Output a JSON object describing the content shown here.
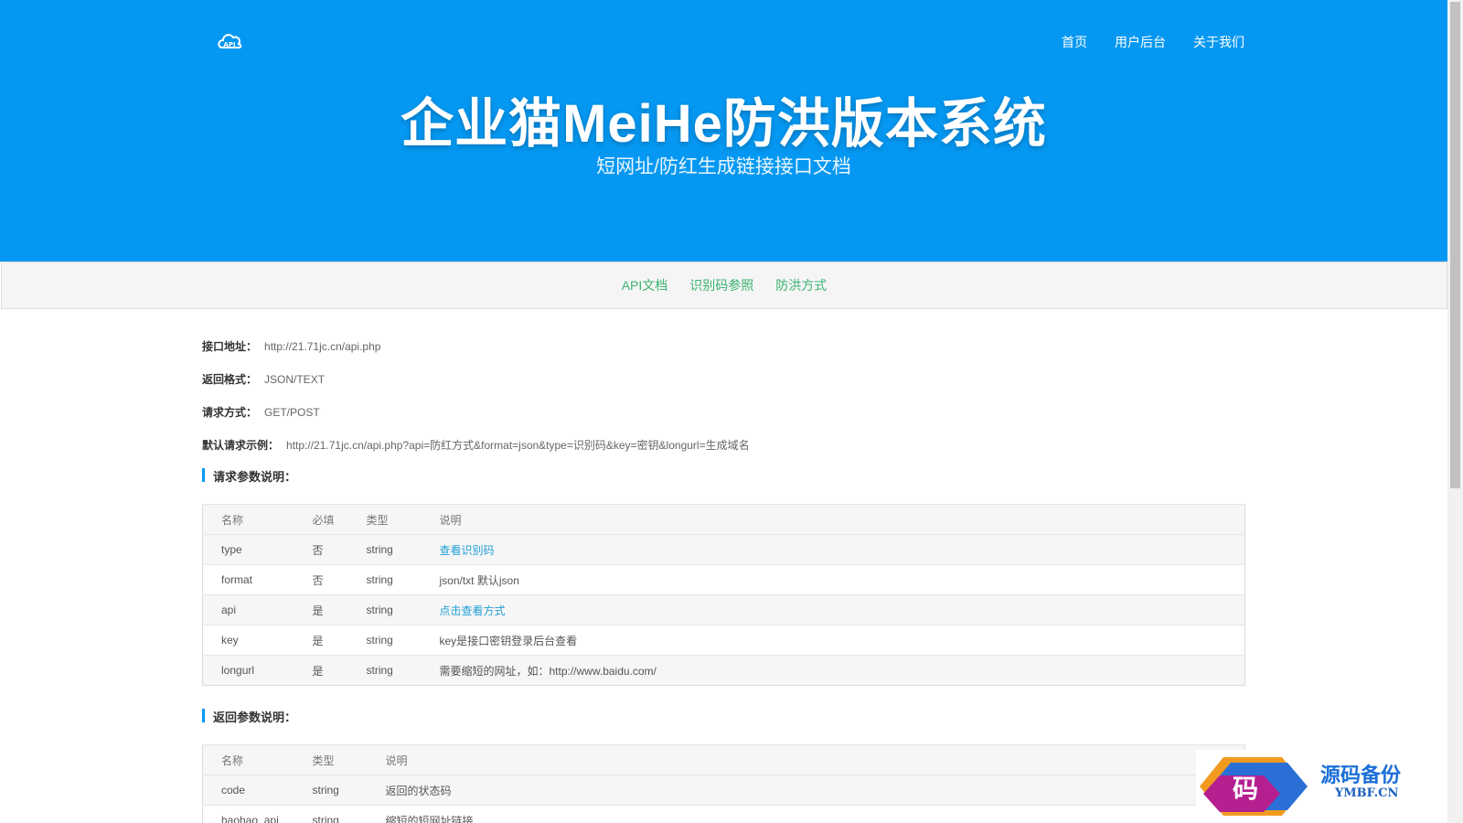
{
  "header": {
    "logo_label": "API",
    "nav": [
      "首页",
      "用户后台",
      "关于我们"
    ],
    "title": "企业猫MeiHe防洪版本系统",
    "subtitle": "短网址/防红生成链接接口文档"
  },
  "tabs": [
    "API文档",
    "识别码参照",
    "防洪方式"
  ],
  "info": [
    {
      "label": "接口地址：",
      "value": "http://21.71jc.cn/api.php"
    },
    {
      "label": "返回格式：",
      "value": "JSON/TEXT"
    },
    {
      "label": "请求方式：",
      "value": "GET/POST"
    },
    {
      "label": "默认请求示例：",
      "value": "http://21.71jc.cn/api.php?api=防红方式&format=json&type=识别码&key=密钥&longurl=生成域名"
    }
  ],
  "request_params": {
    "title": "请求参数说明：",
    "headers": [
      "名称",
      "必填",
      "类型",
      "说明"
    ],
    "rows": [
      [
        "type",
        "否",
        "string",
        "查看识别码"
      ],
      [
        "format",
        "否",
        "string",
        "json/txt 默认json"
      ],
      [
        "api",
        "是",
        "string",
        "点击查看方式"
      ],
      [
        "key",
        "是",
        "string",
        "key是接口密钥登录后台查看"
      ],
      [
        "longurl",
        "是",
        "string",
        "需要缩短的网址，如：http://www.baidu.com/"
      ]
    ]
  },
  "response_params": {
    "title": "返回参数说明：",
    "headers": [
      "名称",
      "类型",
      "说明"
    ],
    "rows": [
      [
        "code",
        "string",
        "返回的状态码"
      ],
      [
        "haohao_api",
        "string",
        "缩短的短网址链接"
      ]
    ]
  },
  "watermark": {
    "glyph": "码",
    "text": "源码备份",
    "sub": "YMBF.CN"
  },
  "colors": {
    "hero_bg": "#0598f2",
    "tab_text": "#3cb371",
    "link": "#1e9fd6"
  }
}
